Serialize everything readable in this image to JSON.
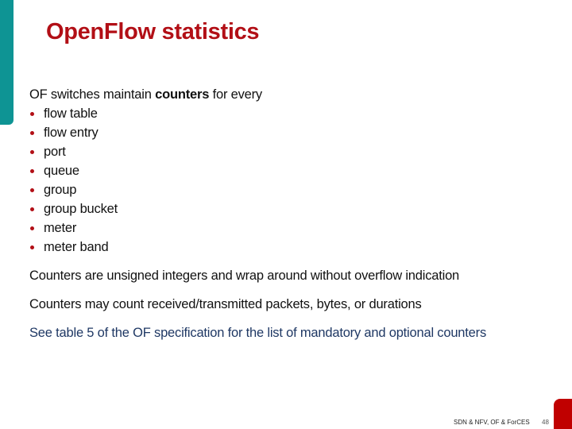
{
  "slide": {
    "title": "OpenFlow statistics",
    "intro": {
      "prefix": "OF switches maintain ",
      "emphasis": "counters",
      "suffix": " for every"
    },
    "bullets": [
      "flow table",
      "flow entry",
      "port",
      "queue",
      "group",
      "group bucket",
      "meter",
      "meter band"
    ],
    "paragraphs": [
      "Counters are unsigned integers and wrap around without overflow indication",
      "Counters may count received/transmitted packets, bytes, or durations",
      "See table 5 of the OF specification for the list of mandatory and optional counters"
    ],
    "footer": {
      "text": "SDN & NFV, OF & ForCES",
      "page_number": "48"
    }
  },
  "colors": {
    "title": "#b20f16",
    "accent_teal": "#0e9494",
    "accent_red": "#c00000",
    "bullet": "#b20f16",
    "note_text": "#1f3864"
  }
}
